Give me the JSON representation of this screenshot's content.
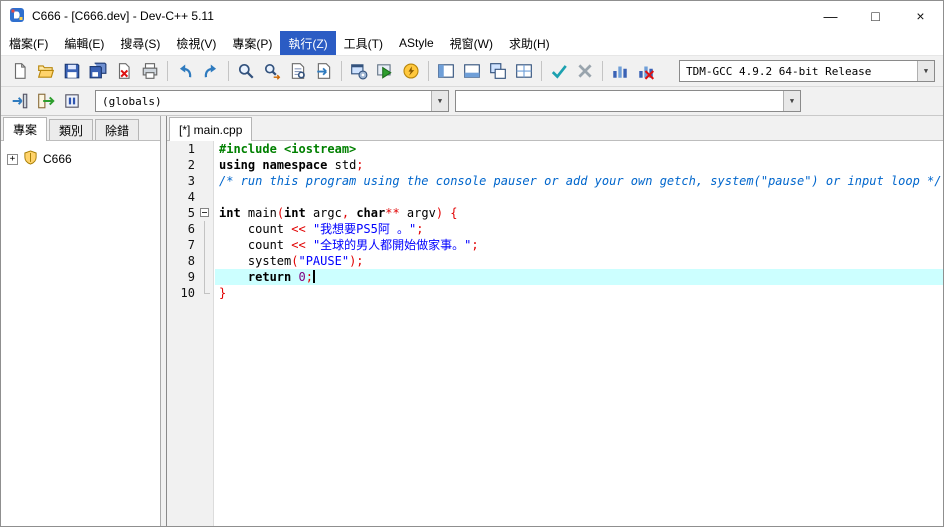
{
  "window": {
    "title": "C666 - [C666.dev] - Dev-C++ 5.11",
    "controls": {
      "minimize": "—",
      "maximize": "□",
      "close": "×"
    }
  },
  "menu": {
    "items": [
      {
        "name": "file",
        "label": "檔案(F)",
        "active": false
      },
      {
        "name": "edit",
        "label": "編輯(E)",
        "active": false
      },
      {
        "name": "search",
        "label": "搜尋(S)",
        "active": false
      },
      {
        "name": "view",
        "label": "檢視(V)",
        "active": false
      },
      {
        "name": "project",
        "label": "專案(P)",
        "active": false
      },
      {
        "name": "execute",
        "label": "執行(Z)",
        "active": true
      },
      {
        "name": "tools",
        "label": "工具(T)",
        "active": false
      },
      {
        "name": "astyle",
        "label": "AStyle",
        "active": false
      },
      {
        "name": "window",
        "label": "視窗(W)",
        "active": false
      },
      {
        "name": "help",
        "label": "求助(H)",
        "active": false
      }
    ]
  },
  "toolbar_main": {
    "groups": [
      [
        "new-source",
        "open",
        "save",
        "save-all",
        "close-file",
        "print"
      ],
      [
        "undo",
        "redo"
      ],
      [
        "find",
        "replace",
        "find-next",
        "goto-line"
      ],
      [
        "compile",
        "run",
        "compile-run"
      ],
      [
        "view-project",
        "view-report",
        "view-floating",
        "view-fullscreen"
      ],
      [
        "syntax-check",
        "abort"
      ],
      [
        "profile",
        "delete-profile"
      ]
    ],
    "compiler_select": {
      "value": "TDM-GCC 4.9.2 64-bit Release"
    }
  },
  "toolbar_specials": {
    "icons": [
      "insert",
      "toggle-bookmark",
      "goto-bookmark"
    ],
    "globals_select": {
      "value": "(globals)"
    },
    "members_select": {
      "value": ""
    }
  },
  "glyphs": {
    "dropdown_arrow": "▼"
  },
  "sidebar": {
    "tabs": [
      {
        "name": "project",
        "label": "專案",
        "active": true
      },
      {
        "name": "classes",
        "label": "類別",
        "active": false
      },
      {
        "name": "debug",
        "label": "除錯",
        "active": false
      }
    ],
    "tree": [
      {
        "label": "C666",
        "expander": "+",
        "icon": "project-shield"
      }
    ]
  },
  "editor": {
    "tab": "[*] main.cpp",
    "current_line": 9,
    "lines": [
      {
        "n": 1,
        "tokens": [
          {
            "t": "#include <iostream>",
            "c": "pre"
          }
        ]
      },
      {
        "n": 2,
        "tokens": [
          {
            "t": "using",
            "c": "kw"
          },
          {
            "t": " ",
            "c": "pl"
          },
          {
            "t": "namespace",
            "c": "kw"
          },
          {
            "t": " std",
            "c": "pl"
          },
          {
            "t": ";",
            "c": "sym"
          }
        ]
      },
      {
        "n": 3,
        "tokens": [
          {
            "t": "/* run this program using the console pauser or add your own getch, system(\"pause\") or input loop */",
            "c": "com"
          }
        ]
      },
      {
        "n": 4,
        "tokens": []
      },
      {
        "n": 5,
        "fold": "start",
        "tokens": [
          {
            "t": "int",
            "c": "kw"
          },
          {
            "t": " main",
            "c": "pl"
          },
          {
            "t": "(",
            "c": "sym"
          },
          {
            "t": "int",
            "c": "kw"
          },
          {
            "t": " argc",
            "c": "pl"
          },
          {
            "t": ",",
            "c": "sym"
          },
          {
            "t": " ",
            "c": "pl"
          },
          {
            "t": "char",
            "c": "kw"
          },
          {
            "t": "**",
            "c": "sym"
          },
          {
            "t": " argv",
            "c": "pl"
          },
          {
            "t": ")",
            "c": "sym"
          },
          {
            "t": " ",
            "c": "pl"
          },
          {
            "t": "{",
            "c": "sym"
          }
        ]
      },
      {
        "n": 6,
        "fold": "line",
        "tokens": [
          {
            "t": "    count ",
            "c": "pl"
          },
          {
            "t": "<<",
            "c": "sym"
          },
          {
            "t": " ",
            "c": "pl"
          },
          {
            "t": "\"我想要PS5阿 。\"",
            "c": "str"
          },
          {
            "t": ";",
            "c": "sym"
          }
        ]
      },
      {
        "n": 7,
        "fold": "line",
        "tokens": [
          {
            "t": "    count ",
            "c": "pl"
          },
          {
            "t": "<<",
            "c": "sym"
          },
          {
            "t": " ",
            "c": "pl"
          },
          {
            "t": "\"全球的男人都開始做家事。\"",
            "c": "str"
          },
          {
            "t": ";",
            "c": "sym"
          }
        ]
      },
      {
        "n": 8,
        "fold": "line",
        "tokens": [
          {
            "t": "    system",
            "c": "pl"
          },
          {
            "t": "(",
            "c": "sym"
          },
          {
            "t": "\"PAUSE\"",
            "c": "str"
          },
          {
            "t": ")",
            "c": "sym"
          },
          {
            "t": ";",
            "c": "sym"
          }
        ]
      },
      {
        "n": 9,
        "fold": "line",
        "tokens": [
          {
            "t": "    ",
            "c": "pl"
          },
          {
            "t": "return",
            "c": "kw"
          },
          {
            "t": " ",
            "c": "pl"
          },
          {
            "t": "0",
            "c": "num"
          },
          {
            "t": ";",
            "c": "sym"
          }
        ]
      },
      {
        "n": 10,
        "fold": "end",
        "tokens": [
          {
            "t": "}",
            "c": "sym"
          }
        ]
      }
    ]
  },
  "colors": {
    "preprocessor": "#008000",
    "keyword": "#000000",
    "plain": "#000000",
    "symbol": "#e10000",
    "string": "#0000ff",
    "comment": "#0066cc",
    "number": "#800080",
    "current_line_bg": "#ccffff",
    "menu_highlight": "#2b5cc4",
    "toolbar_bg": "#f1f1f1"
  }
}
